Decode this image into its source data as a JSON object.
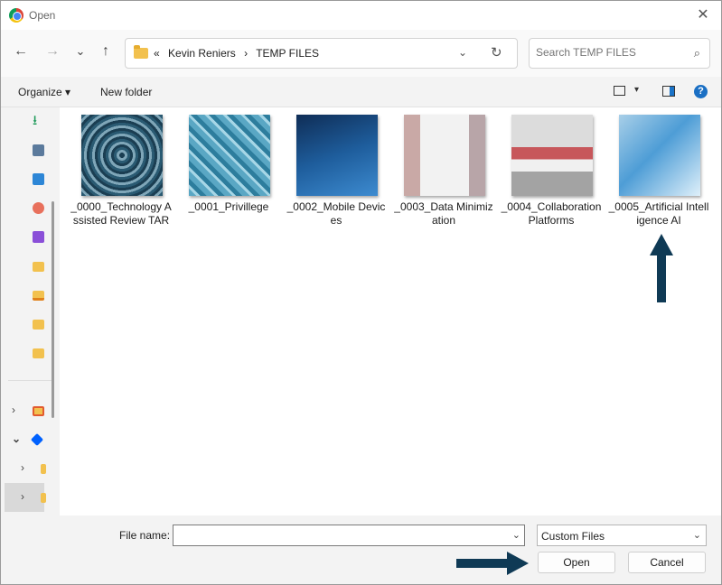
{
  "window": {
    "title": "Open",
    "close_glyph": "✕"
  },
  "nav": {
    "back": "←",
    "forward": "→",
    "recent": "⌄",
    "up": "↑",
    "breadcrumbs": [
      "«",
      "Kevin Reniers",
      "›",
      "TEMP FILES"
    ],
    "address_dropdown": "⌄",
    "refresh": "↻",
    "search_placeholder": "Search TEMP FILES",
    "search_icon": "⌕"
  },
  "toolbar": {
    "organize": "Organize ▾",
    "new_folder": "New folder",
    "view_dropdown": "▾",
    "help": "?"
  },
  "sidebar": {
    "items": [
      {
        "icon": "download-icon",
        "color": "#1e9a5a"
      },
      {
        "icon": "document-icon",
        "color": "#5b7a9c"
      },
      {
        "icon": "pictures-icon",
        "color": "#2d86d6"
      },
      {
        "icon": "music-icon",
        "color": "#e8705c"
      },
      {
        "icon": "videos-icon",
        "color": "#8a4fd8"
      },
      {
        "icon": "folder-icon",
        "color": "#f2c14e"
      },
      {
        "icon": "folder-download-icon",
        "color": "#f2c14e"
      },
      {
        "icon": "folder-icon",
        "color": "#f2c14e"
      },
      {
        "icon": "folder-icon",
        "color": "#f2c14e"
      }
    ],
    "tree": [
      {
        "chevron": "›",
        "icon": "shared-folder-icon"
      },
      {
        "chevron": "⌄",
        "icon": "dropbox-icon"
      },
      {
        "chevron": "›",
        "icon": "folder-icon"
      },
      {
        "chevron": "›",
        "icon": "folder-icon"
      }
    ]
  },
  "files": [
    {
      "name": "_0000_Technology Assisted Review TAR"
    },
    {
      "name": "_0001_Privillege"
    },
    {
      "name": "_0002_Mobile Devices"
    },
    {
      "name": "_0003_Data Minimization"
    },
    {
      "name": "_0004_Collaboration Platforms"
    },
    {
      "name": "_0005_Artificial Intelligence AI"
    }
  ],
  "footer": {
    "file_name_label": "File name:",
    "file_name_value": "",
    "file_type": "Custom Files",
    "dropdown": "⌄",
    "open": "Open",
    "cancel": "Cancel"
  },
  "colors": {
    "annotation_arrow": "#0f3a55"
  }
}
